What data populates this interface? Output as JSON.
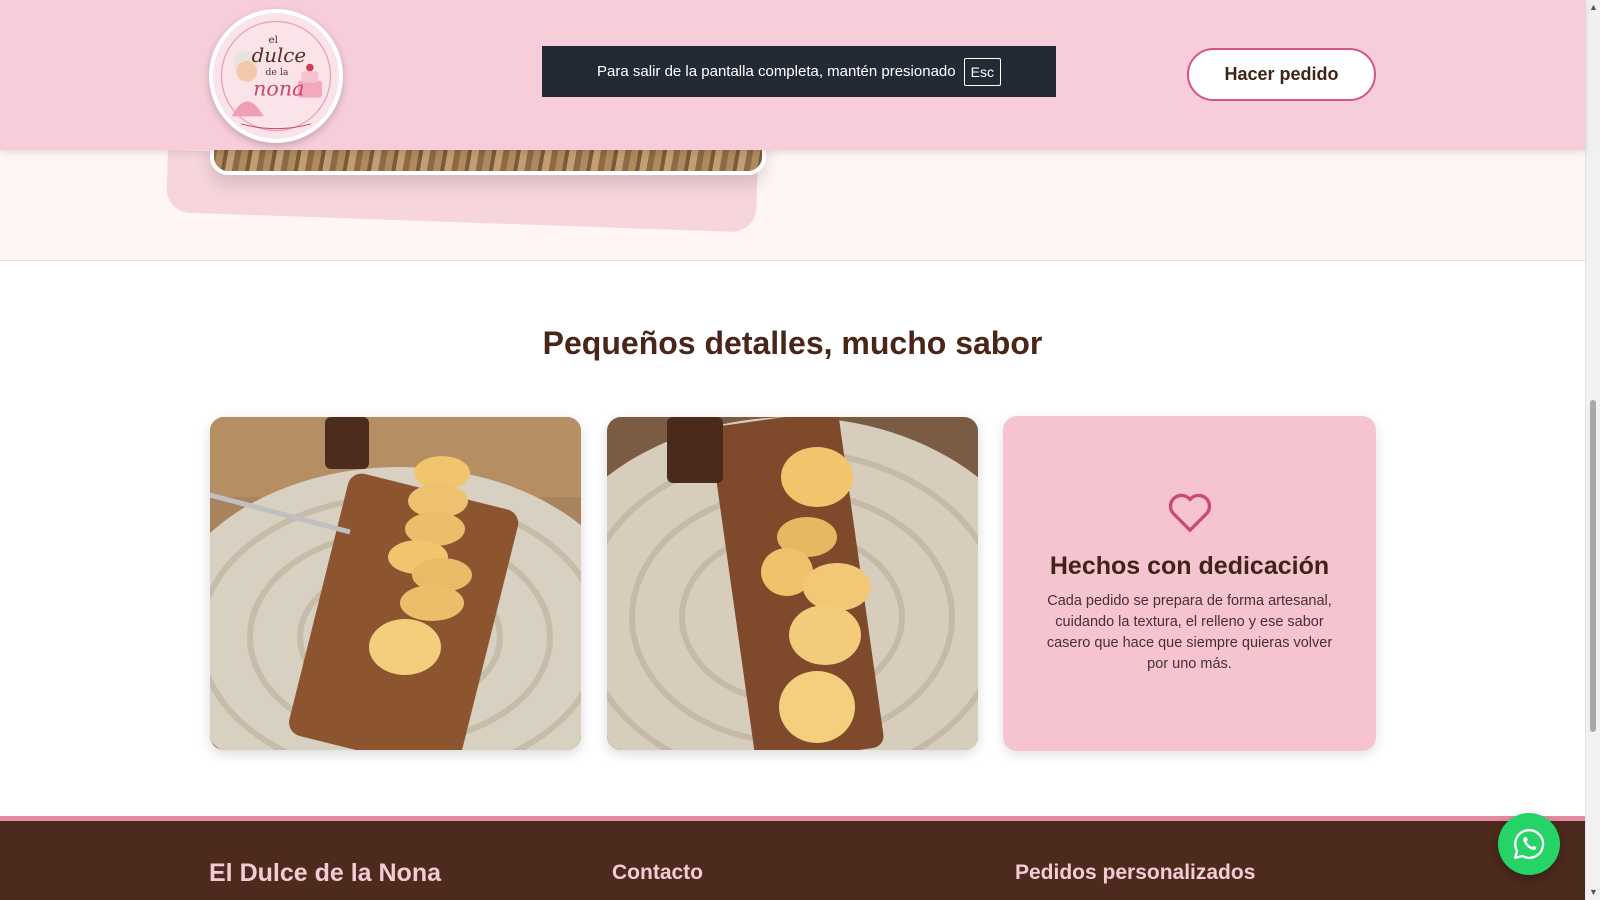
{
  "header": {
    "logo": {
      "line1": "el",
      "line2": "dulce",
      "line3": "de la",
      "line4": "nona",
      "alt": "El Dulce de la Nona logo"
    },
    "order_button": "Hacer pedido"
  },
  "fullscreen_toast": {
    "message": "Para salir de la pantalla completa, mantén presionado",
    "key": "Esc"
  },
  "gallery": {
    "title": "Pequeños detalles, mucho sabor",
    "info_card": {
      "icon": "heart-icon",
      "title": "Hechos con dedicación",
      "text": "Cada pedido se prepara de forma artesanal, cuidando la textura, el relleno y ese sabor casero que hace que siempre quieras volver por uno más."
    }
  },
  "footer": {
    "brand": "El Dulce de la Nona",
    "contact_heading": "Contacto",
    "custom_orders_heading": "Pedidos personalizados"
  },
  "whatsapp": {
    "icon": "whatsapp-icon"
  },
  "colors": {
    "header_bg": "#f6cdd8",
    "accent_pink": "#d7567f",
    "card_pink": "#f6c4d1",
    "brown_text": "#4a2618",
    "footer_bg": "#4c2a1e",
    "whatsapp_green": "#25d366"
  }
}
